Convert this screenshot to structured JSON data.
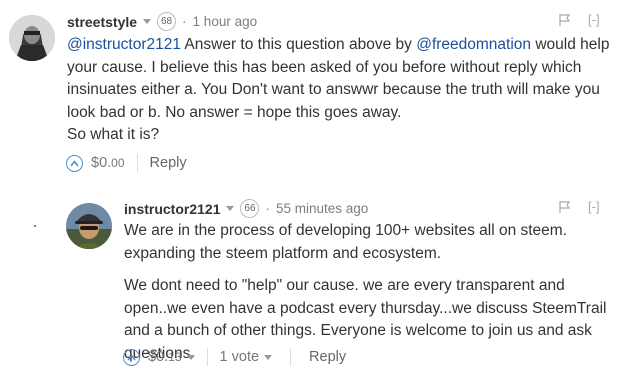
{
  "comments": [
    {
      "author": "streetstyle",
      "reputation": "68",
      "time": "1 hour ago",
      "collapse": "[-]",
      "body": {
        "mention1": "@instructor2121",
        "text1": " Answer to this question above by ",
        "mention2": "@freedomnation",
        "text2": " would help your cause. I believe this has been asked of you before without reply which insinuates either a. You Don't want to answwr because the truth will make you look bad or b. No answer = hope this goes away.",
        "text3": "So what it is?"
      },
      "payout_main": "$0.",
      "payout_cents": "00",
      "reply_label": "Reply"
    },
    {
      "author": "instructor2121",
      "reputation": "66",
      "time": "55 minutes ago",
      "collapse": "[-]",
      "body": {
        "para1": "We are in the process of developing 100+ websites all on steem. expanding the steem platform and ecosystem.",
        "para2": "We dont need to \"help\" our cause. we are every transparent and open..we even have a podcast every thursday...we discuss SteemTrail and a bunch of other things. Everyone is welcome to join us and ask questions."
      },
      "payout_main": "$0.",
      "payout_cents": "13",
      "votes_label": "1 vote",
      "reply_label": "Reply"
    }
  ],
  "colors": {
    "link": "#1a5099",
    "vote_accent": "#4c8ec9"
  },
  "icons": [
    "flag-icon",
    "upvote-icon",
    "chevron-down-icon"
  ]
}
